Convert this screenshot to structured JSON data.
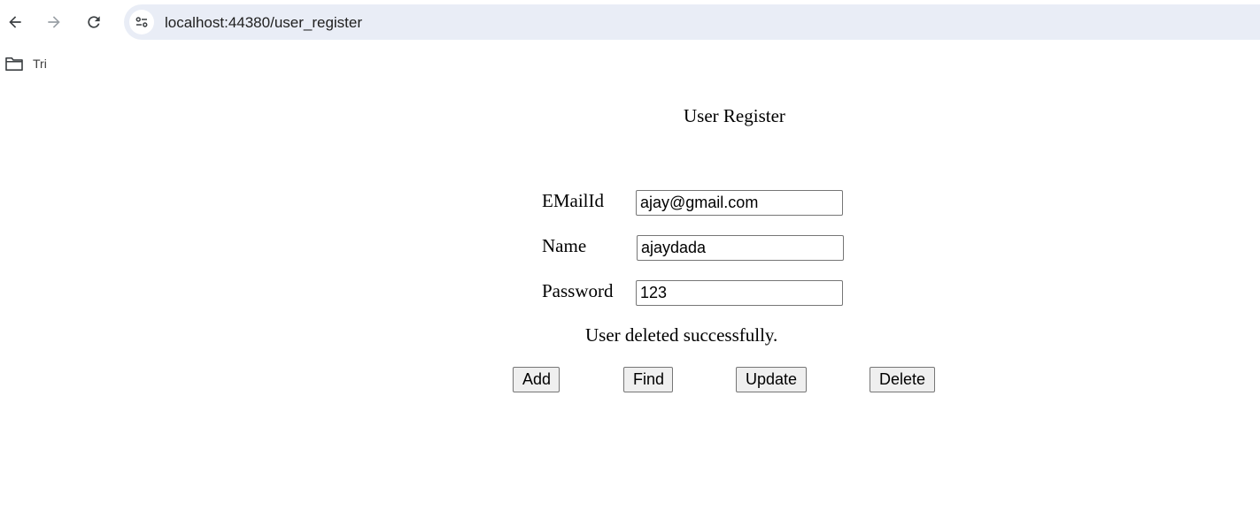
{
  "browser": {
    "url": "localhost:44380/user_register",
    "icons": {
      "back": "arrow-left-icon",
      "forward": "arrow-right-icon",
      "reload": "reload-icon",
      "site_info": "tune-icon",
      "bookmark_folder": "folder-icon"
    },
    "colors": {
      "omnibox_bg": "#e9edf6",
      "forward_disabled": "#9aa0a6"
    }
  },
  "bookmarks": {
    "items": [
      {
        "label": "Tri"
      }
    ]
  },
  "form": {
    "title": "User Register",
    "email_label": "EMailId",
    "email_value": "ajay@gmail.com",
    "name_label": "Name",
    "name_value": "ajaydada",
    "password_label": "Password",
    "password_value": "123",
    "status_message": "User deleted successfully.",
    "buttons": {
      "add": "Add",
      "find": "Find",
      "update": "Update",
      "delete": "Delete"
    }
  }
}
